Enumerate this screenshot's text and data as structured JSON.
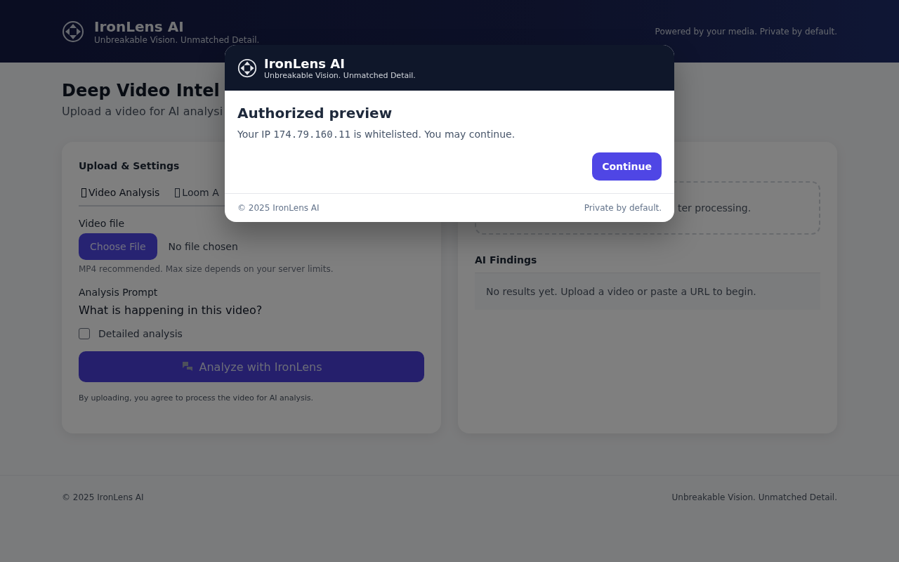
{
  "header": {
    "brand": "IronLens AI",
    "tagline": "Unbreakable Vision. Unmatched Detail.",
    "note": "Powered by your media. Private by default."
  },
  "hero": {
    "title": "Deep Video Intel",
    "subtitle": "Upload a video for AI analysi"
  },
  "upload_card": {
    "title": "Upload & Settings",
    "tabs": [
      {
        "label": "Video Analysis",
        "selected": true
      },
      {
        "label": "Loom A",
        "selected": false
      }
    ],
    "file_label": "Video file",
    "choose_button": "Choose File",
    "file_status": "No file chosen",
    "file_hint": "MP4 recommended. Max size depends on your server limits.",
    "prompt_label": "Analysis Prompt",
    "prompt_value": "What is happening in this video?",
    "detailed": {
      "label": "Detailed analysis",
      "checked": false
    },
    "analyze_button": "Analyze with IronLens",
    "consent": "By uploading, you agree to process the video for AI analysis."
  },
  "results_card": {
    "preview_text": "ter processing.",
    "findings_title": "AI Findings",
    "findings_empty": "No results yet. Upload a video or paste a URL to begin."
  },
  "footer": {
    "copyright": "© 2025 IronLens AI",
    "tagline": "Unbreakable Vision. Unmatched Detail."
  },
  "modal": {
    "brand": "IronLens AI",
    "tagline": "Unbreakable Vision. Unmatched Detail.",
    "title": "Authorized preview",
    "text_before": "Your IP",
    "ip": "174.79.160.11",
    "text_after": "is whitelisted. You may continue.",
    "button": "Continue",
    "footer_left": "© 2025 IronLens AI",
    "footer_right": "Private by default."
  }
}
